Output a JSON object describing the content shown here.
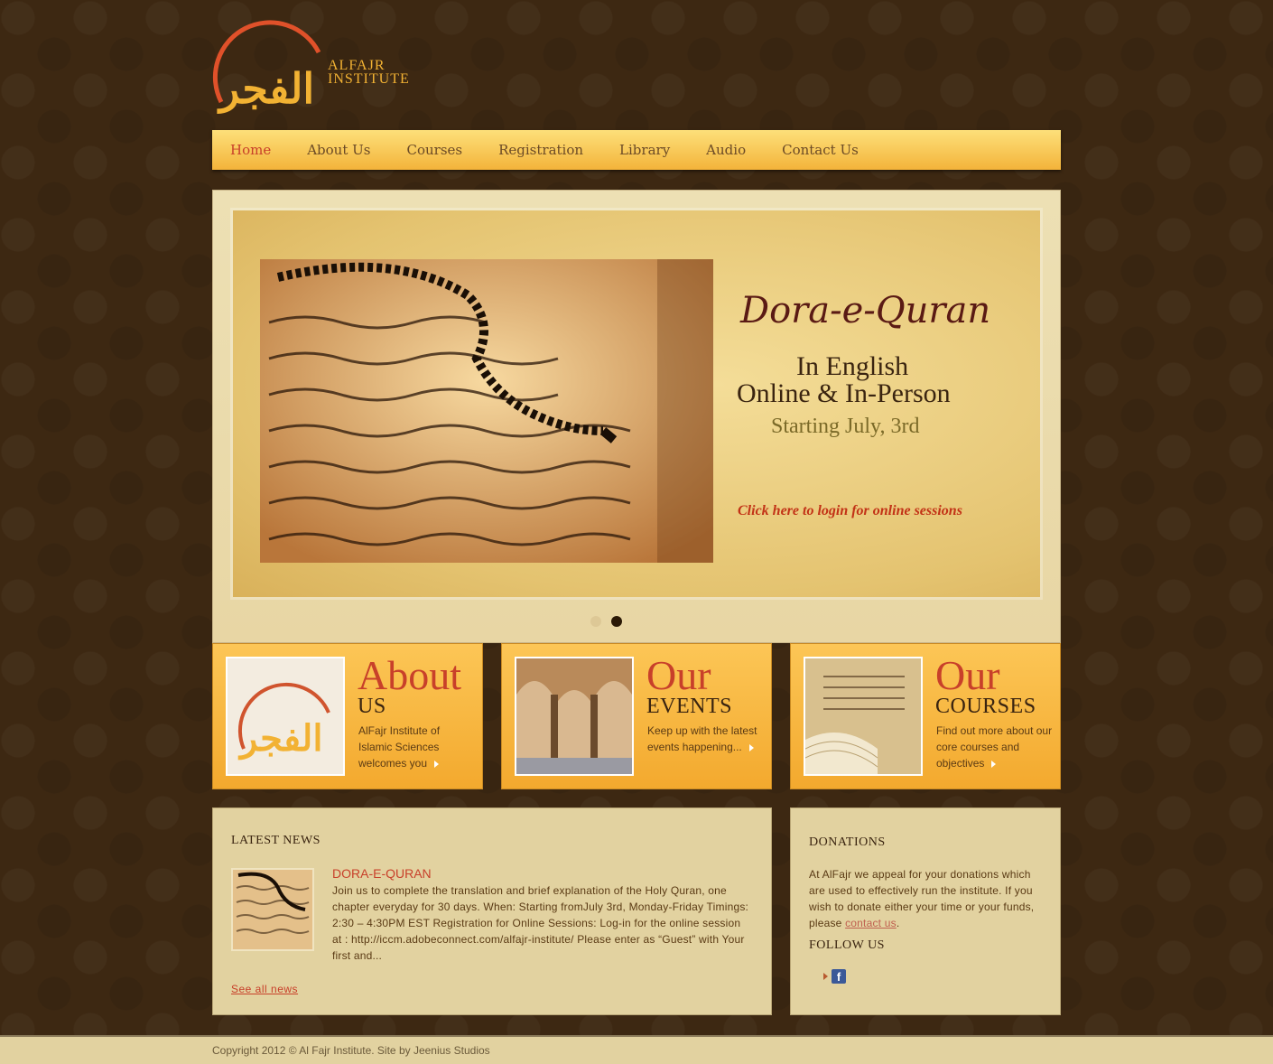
{
  "logo": {
    "line1": "ALFAJR",
    "line2": "INSTITUTE"
  },
  "nav": {
    "items": [
      "Home",
      "About Us",
      "Courses",
      "Registration",
      "Library",
      "Audio",
      "Contact Us"
    ],
    "active": "Home"
  },
  "slider": {
    "title": "Dora-e-Quran",
    "line1": "In English",
    "line2": "Online & In-Person",
    "line3": "Starting July, 3rd",
    "link": "Click here to login for online sessions",
    "slides_total": 2,
    "active_slide": 2
  },
  "features": [
    {
      "big": "About",
      "small": "US",
      "desc": "AlFajr Institute of Islamic Sciences welcomes you"
    },
    {
      "big": "Our",
      "small": "EVENTS",
      "desc": "Keep up with the latest events happening..."
    },
    {
      "big": "Our",
      "small": "COURSES",
      "desc": "Find out more about our core courses and objectives"
    }
  ],
  "news": {
    "heading": "LATEST NEWS",
    "item_title": "DORA-E-QURAN",
    "item_text": "Join us to complete the translation and brief explanation of the Holy Quran, one chapter everyday for 30 days. When: Starting fromJuly 3rd, Monday-Friday Timings: 2:30 – 4:30PM EST Registration for Online Sessions: Log-in for the online session at : http://iccm.adobeconnect.com/alfajr-institute/ Please enter as “Guest” with Your first and...",
    "see_all": "See all news"
  },
  "donations": {
    "heading": "DONATIONS",
    "text_before": "At AlFajr we appeal for your donations which are used to effectively run the institute. If you wish to donate either your time or your funds, please ",
    "link": "contact us",
    "text_after": ".",
    "follow_heading": "FOLLOW US",
    "facebook_icon": "facebook-icon"
  },
  "footer": {
    "text": "Copyright 2012 © Al Fajr Institute. Site by Jeenius Studios"
  },
  "colors": {
    "accent": "#c8402a",
    "nav_gold": "#f3b33a",
    "background": "#3d2812",
    "panel": "#e2d2a0"
  }
}
